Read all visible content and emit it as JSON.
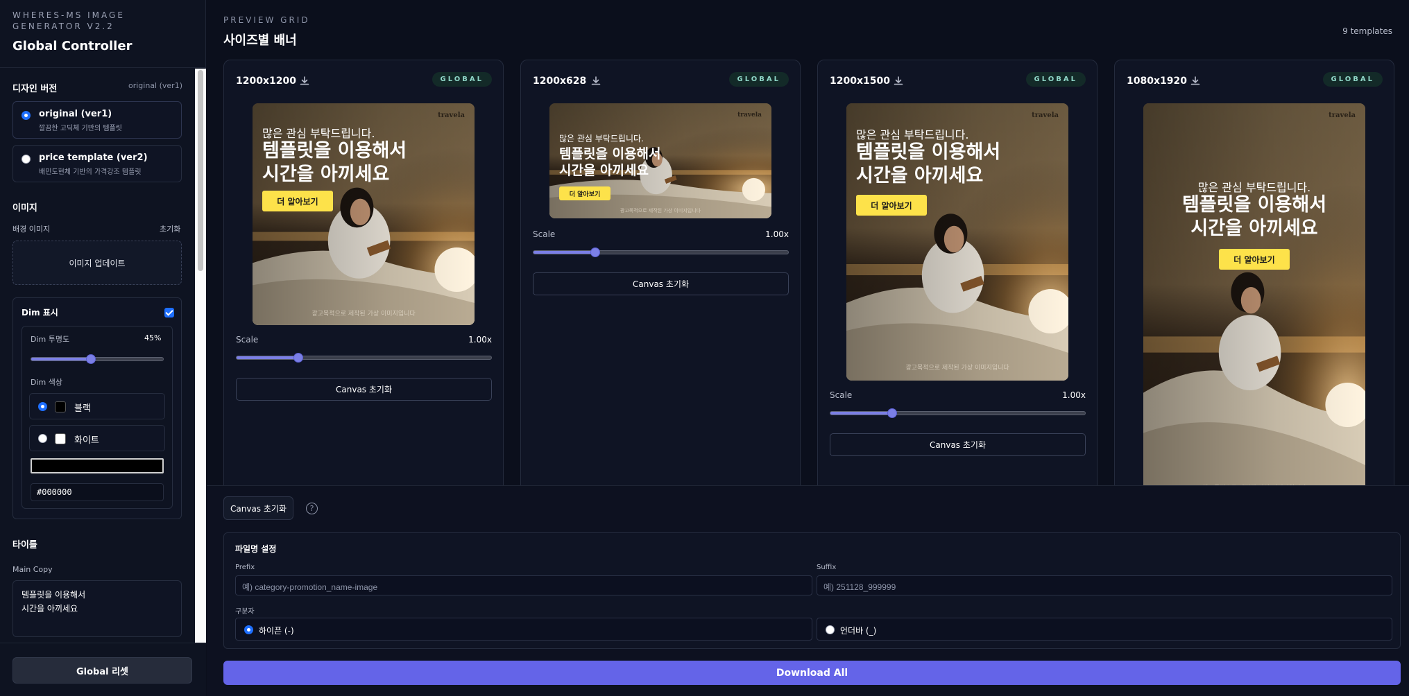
{
  "app": {
    "name": "WHERES-MS IMAGE GENERATOR V2.2",
    "title": "Global Controller"
  },
  "sidebar": {
    "design_version": {
      "label": "디자인 버전",
      "current": "original (ver1)",
      "options": [
        {
          "title": "original (ver1)",
          "desc": "깔끔한 고딕체 기반의 템플릿",
          "selected": true
        },
        {
          "title": "price template (ver2)",
          "desc": "배민도현체 기반의 가격강조 템플릿",
          "selected": false
        }
      ]
    },
    "image": {
      "label": "이미지",
      "bg_label": "배경 이미지",
      "reset_label": "초기화",
      "update_label": "이미지 업데이트"
    },
    "dim": {
      "label": "Dim 표시",
      "checked": true,
      "opacity_label": "Dim 투명도",
      "opacity_value": "45%",
      "opacity_fraction": 0.45,
      "color_label": "Dim 색상",
      "colors": [
        {
          "label": "블랙",
          "swatch": "#000000",
          "selected": true
        },
        {
          "label": "화이트",
          "swatch": "#ffffff",
          "selected": false
        }
      ],
      "hex": "#000000"
    },
    "title_section": {
      "label": "타이틀",
      "main_copy_label": "Main Copy",
      "main_copy": "템플릿을 이용해서\n시간을 아끼세요"
    },
    "global_reset_label": "Global 리셋"
  },
  "main": {
    "preview_label": "PREVIEW GRID",
    "title": "사이즈별 배너",
    "count": "9 templates",
    "banner": {
      "brand": "travela",
      "sub": "많은 관심 부탁드립니다.",
      "title": "템플릿을 이용해서\n시간을 아끼세요",
      "cta": "더 알아보기",
      "disclaimer": "광고목적으로 제작된 가상 이미지입니다"
    },
    "cards": [
      {
        "size": "1200x1200",
        "badge": "GLOBAL",
        "scale_label": "Scale",
        "scale_value": "1.00x",
        "scale_fraction": 0.24,
        "reset_label": "Canvas 초기화"
      },
      {
        "size": "1200x628",
        "badge": "GLOBAL",
        "scale_label": "Scale",
        "scale_value": "1.00x",
        "scale_fraction": 0.24,
        "reset_label": "Canvas 초기화"
      },
      {
        "size": "1200x1500",
        "badge": "GLOBAL",
        "scale_label": "Scale",
        "scale_value": "1.00x",
        "scale_fraction": 0.24,
        "reset_label": "Canvas 초기화"
      },
      {
        "size": "1080x1920",
        "badge": "GLOBAL"
      }
    ]
  },
  "bottom": {
    "reset_label": "Canvas 초기화",
    "help_icon": "?",
    "filename": {
      "title": "파일명 설정",
      "prefix_label": "Prefix",
      "prefix_placeholder": "예) category-promotion_name-image",
      "suffix_label": "Suffix",
      "suffix_placeholder": "예) 251128_999999",
      "separator_label": "구분자",
      "separators": [
        {
          "label": "하이픈 (-)",
          "selected": true
        },
        {
          "label": "언더바 (_)",
          "selected": false
        }
      ]
    },
    "download_all_label": "Download All"
  },
  "colors": {
    "accent": "#6464e8",
    "cta": "#fde24a",
    "badge": "#8fd6c7"
  }
}
